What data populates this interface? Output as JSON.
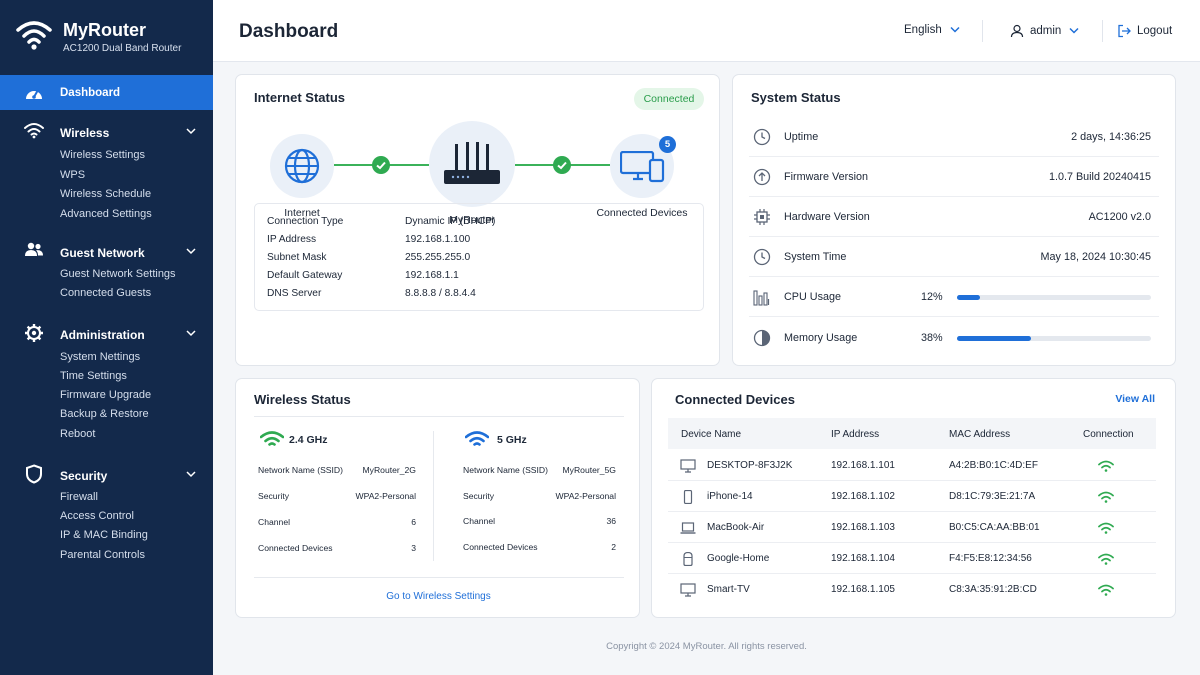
{
  "brand": {
    "name": "MyRouter",
    "model": "AC1200 Dual Band Router"
  },
  "sidebar": {
    "active": "Dashboard",
    "groups": [
      {
        "label": "Wireless",
        "icon": "wifi-icon",
        "items": [
          "Wireless Settings",
          "WPS",
          "Wireless Schedule",
          "Advanced Settings"
        ]
      },
      {
        "label": "Guest Network",
        "icon": "users-icon",
        "items": [
          "Guest Network Settings",
          "Connected Guests"
        ]
      },
      {
        "label": "Administration",
        "icon": "gear-icon",
        "items": [
          "System Nettings",
          "Time Settings",
          "Firmware Upgrade",
          "Backup & Restore",
          "Reboot"
        ]
      },
      {
        "label": "Security",
        "icon": "shield-icon",
        "items": [
          "Firewall",
          "Access Control",
          "IP & MAC Binding",
          "Parental Controls"
        ]
      }
    ]
  },
  "header": {
    "title": "Dashboard",
    "language": "English",
    "user": "admin",
    "logout": "Logout"
  },
  "internet": {
    "title": "Internet Status",
    "status": "Connected",
    "nodes": {
      "internet": "Internet",
      "router": "MyRouter",
      "devices": "Connected Devices"
    },
    "device_count": "5",
    "rows": [
      {
        "label": "Connection Type",
        "value": "Dynamic IP (DHCP)"
      },
      {
        "label": "IP Address",
        "value": "192.168.1.100"
      },
      {
        "label": "Subnet Mask",
        "value": "255.255.255.0"
      },
      {
        "label": "Default Gateway",
        "value": "192.168.1.1"
      },
      {
        "label": "DNS Server",
        "value": "8.8.8.8 / 8.8.4.4"
      }
    ]
  },
  "system": {
    "title": "System Status",
    "rows": [
      {
        "label": "Uptime",
        "value": "2 days, 14:36:25"
      },
      {
        "label": "Firmware Version",
        "value": "1.0.7 Build 20240415"
      },
      {
        "label": "Hardware Version",
        "value": "AC1200 v2.0"
      },
      {
        "label": "System Time",
        "value": "May 18, 2024 10:30:45"
      }
    ],
    "cpu": {
      "label": "CPU Usage",
      "percent": "12%",
      "value": 0.12
    },
    "memory": {
      "label": "Memory Usage",
      "percent": "38%",
      "value": 0.38
    }
  },
  "wireless": {
    "title": "Wireless Status",
    "bands": [
      {
        "name": "2.4 GHz",
        "color": "#2faa51",
        "ssid_label": "Network Name (SSID)",
        "ssid": "MyRouter_2G",
        "security_label": "Security",
        "security": "WPA2-Personal",
        "channel_label": "Channel",
        "channel": "6",
        "devices_label": "Connected Devices",
        "devices": "3"
      },
      {
        "name": "5 GHz",
        "color": "#1f6fd8",
        "ssid_label": "Network Name (SSID)",
        "ssid": "MyRouter_5G",
        "security_label": "Security",
        "security": "WPA2-Personal",
        "channel_label": "Channel",
        "channel": "36",
        "devices_label": "Connected Devices",
        "devices": "2"
      }
    ],
    "link": "Go to Wireless Settings"
  },
  "devices": {
    "title": "Connected Devices",
    "view_all": "View All",
    "columns": [
      "Device Name",
      "IP Address",
      "MAC Address",
      "Connection"
    ],
    "rows": [
      {
        "name": "DESKTOP-8F3J2K",
        "ip": "192.168.1.101",
        "mac": "A4:2B:B0:1C:4D:EF",
        "icon": "desktop-icon"
      },
      {
        "name": "iPhone-14",
        "ip": "192.168.1.102",
        "mac": "D8:1C:79:3E:21:7A",
        "icon": "phone-icon"
      },
      {
        "name": "MacBook-Air",
        "ip": "192.168.1.103",
        "mac": "B0:C5:CA:AA:BB:01",
        "icon": "laptop-icon"
      },
      {
        "name": "Google-Home",
        "ip": "192.168.1.104",
        "mac": "F4:F5:E8:12:34:56",
        "icon": "speaker-icon"
      },
      {
        "name": "Smart-TV",
        "ip": "192.168.1.105",
        "mac": "C8:3A:35:91:2B:CD",
        "icon": "tv-icon"
      }
    ]
  },
  "footer": "Copyright © 2024 MyRouter. All rights reserved."
}
